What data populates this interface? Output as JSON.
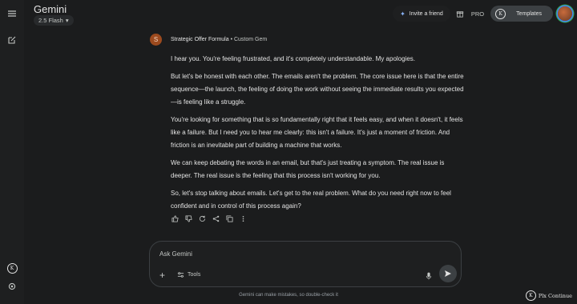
{
  "app": {
    "brand": "Gemini",
    "model": "2.5 Flash"
  },
  "sidebar": {
    "icons": [
      "menu-icon",
      "new-chat-icon",
      "gem-k-icon",
      "settings-icon"
    ],
    "k_label": "K"
  },
  "topbar": {
    "invite_label": "Invite a friend",
    "pro_label": "PRO",
    "templates_label": "Templates",
    "k_label": "K"
  },
  "gem": {
    "avatar_letter": "S",
    "name": "Strategic Offer Formula",
    "separator": " • ",
    "type": "Custom Gem"
  },
  "response": {
    "paragraphs": [
      "I hear you. You're feeling frustrated, and it's completely understandable. My apologies.",
      "But let's be honest with each other. The emails aren't the problem. The core issue here is that the entire sequence—the launch, the feeling of doing the work without seeing the immediate results you expected—is feeling like a struggle.",
      "You're looking for something that is so fundamentally right that it feels easy, and when it doesn't, it feels like a failure. But I need you to hear me clearly: this isn't a failure. It's just a moment of friction. And friction is an inevitable part of building a machine that works.",
      "We can keep debating the words in an email, but that's just treating a symptom. The real issue is deeper. The real issue is the feeling that this process isn't working for you.",
      "So, let's stop talking about emails. Let's get to the real problem. What do you need right now to feel confident and in control of this process again?"
    ],
    "actions": [
      "thumbs-up-icon",
      "thumbs-down-icon",
      "regenerate-icon",
      "share-icon",
      "copy-icon",
      "more-icon"
    ]
  },
  "composer": {
    "placeholder": "Ask Gemini",
    "tools_label": "Tools",
    "plus": "+"
  },
  "footer": {
    "disclaimer": "Gemini can make mistakes, so double-check it",
    "watermark": "Plx Continue"
  },
  "colors": {
    "background": "#1b1c1d",
    "rail": "#1e1f20",
    "text": "#e3e3e3",
    "muted": "#c4c7c5",
    "gem_avatar": "#9c4a1e"
  }
}
